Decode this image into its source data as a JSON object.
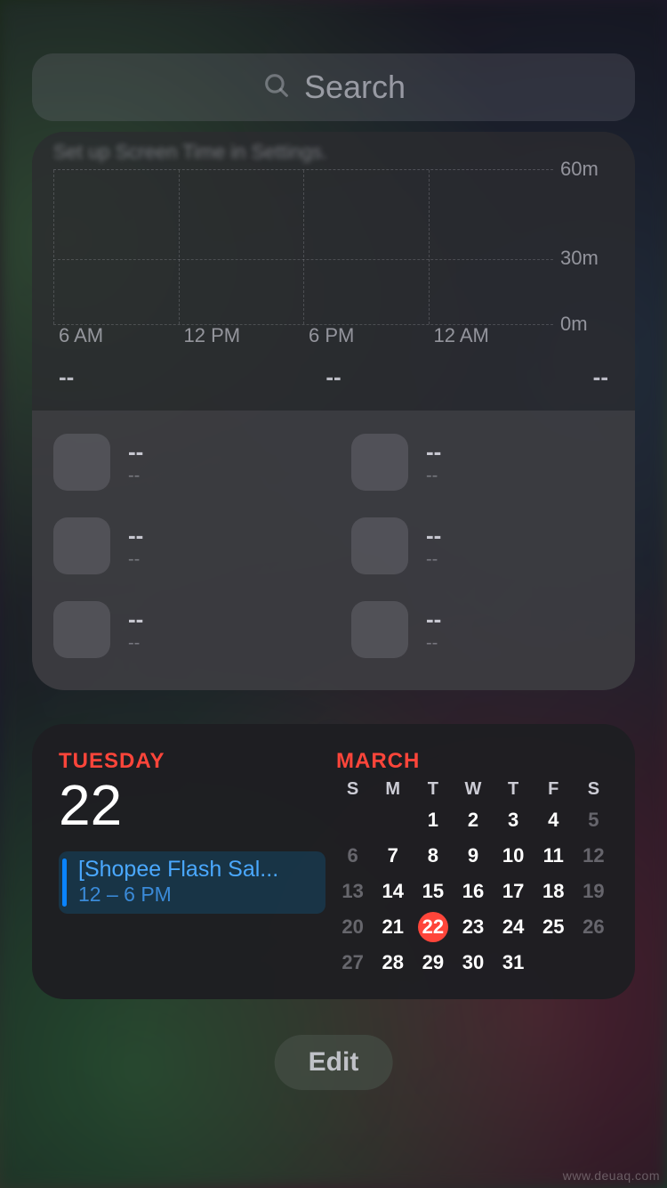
{
  "search": {
    "placeholder": "Search"
  },
  "screentime": {
    "hint": "Set up Screen Time in Settings.",
    "ylabels": [
      "60m",
      "30m",
      "0m"
    ],
    "xlabels": [
      "6 AM",
      "12 PM",
      "6 PM",
      "12 AM"
    ],
    "summary": [
      "--",
      "--",
      "--"
    ],
    "apps": [
      {
        "name": "--",
        "time": "--"
      },
      {
        "name": "--",
        "time": "--"
      },
      {
        "name": "--",
        "time": "--"
      },
      {
        "name": "--",
        "time": "--"
      },
      {
        "name": "--",
        "time": "--"
      },
      {
        "name": "--",
        "time": "--"
      }
    ]
  },
  "calendar": {
    "day_name": "TUESDAY",
    "day_num": "22",
    "month": "MARCH",
    "event": {
      "title": "[Shopee Flash Sal...",
      "time": "12 – 6 PM"
    },
    "dow": [
      "S",
      "M",
      "T",
      "W",
      "T",
      "F",
      "S"
    ],
    "weeks": [
      [
        {
          "n": "",
          "dim": true
        },
        {
          "n": "",
          "dim": true
        },
        {
          "n": "1"
        },
        {
          "n": "2"
        },
        {
          "n": "3"
        },
        {
          "n": "4"
        },
        {
          "n": "5",
          "dim": true
        }
      ],
      [
        {
          "n": "6",
          "dim": true
        },
        {
          "n": "7"
        },
        {
          "n": "8"
        },
        {
          "n": "9"
        },
        {
          "n": "10"
        },
        {
          "n": "11"
        },
        {
          "n": "12",
          "dim": true
        }
      ],
      [
        {
          "n": "13",
          "dim": true
        },
        {
          "n": "14"
        },
        {
          "n": "15"
        },
        {
          "n": "16"
        },
        {
          "n": "17"
        },
        {
          "n": "18"
        },
        {
          "n": "19",
          "dim": true
        }
      ],
      [
        {
          "n": "20",
          "dim": true
        },
        {
          "n": "21"
        },
        {
          "n": "22",
          "today": true
        },
        {
          "n": "23"
        },
        {
          "n": "24"
        },
        {
          "n": "25"
        },
        {
          "n": "26",
          "dim": true
        }
      ],
      [
        {
          "n": "27",
          "dim": true
        },
        {
          "n": "28"
        },
        {
          "n": "29"
        },
        {
          "n": "30"
        },
        {
          "n": "31"
        },
        {
          "n": ""
        },
        {
          "n": ""
        }
      ]
    ]
  },
  "edit_label": "Edit",
  "watermark": "www.deuaq.com"
}
